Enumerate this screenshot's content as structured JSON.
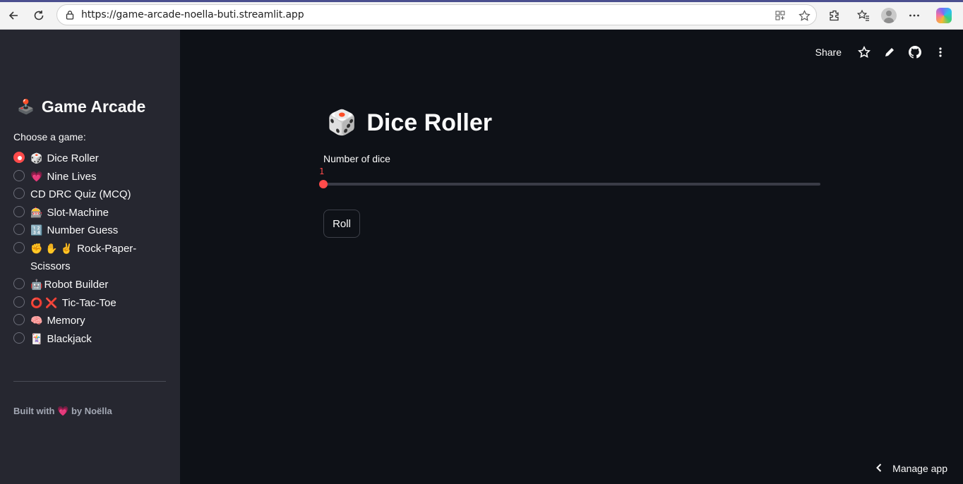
{
  "browser": {
    "url": "https://game-arcade-noella-buti.streamlit.app"
  },
  "sidebar": {
    "title_emoji": "🕹️",
    "title": "Game Arcade",
    "choose_label": "Choose a game:",
    "items": [
      {
        "emoji": "🎲",
        "label": "Dice Roller",
        "selected": true
      },
      {
        "emoji": "💗",
        "label": "Nine Lives",
        "selected": false
      },
      {
        "emoji": "",
        "label": "CD DRC Quiz (MCQ)",
        "selected": false
      },
      {
        "emoji": "🎰",
        "label": "Slot-Machine",
        "selected": false
      },
      {
        "emoji": "🔢",
        "label": "Number Guess",
        "selected": false
      },
      {
        "emoji": "✊ ✋ ✌️",
        "label": "Rock-Paper-Scissors",
        "selected": false
      },
      {
        "emoji": "🤖",
        "label": "Robot Builder",
        "selected": false
      },
      {
        "emoji": "⭕ ❌",
        "label": "Tic-Tac-Toe",
        "selected": false
      },
      {
        "emoji": "🧠",
        "label": "Memory",
        "selected": false
      },
      {
        "emoji": "🃏",
        "label": "Blackjack",
        "selected": false
      }
    ],
    "footer_prefix": "Built with",
    "footer_heart": "💗",
    "footer_suffix": "by Noëlla"
  },
  "header": {
    "share_label": "Share"
  },
  "main": {
    "title_emoji": "🎲",
    "title": "Dice Roller",
    "slider": {
      "label": "Number of dice",
      "value": "1",
      "min": 1,
      "max": 10,
      "fraction": 0
    },
    "roll_label": "Roll"
  },
  "manage_app_label": "Manage app",
  "colors": {
    "accent": "#ff4b4b",
    "sidebar_bg": "#262730",
    "main_bg": "#0e1117"
  }
}
